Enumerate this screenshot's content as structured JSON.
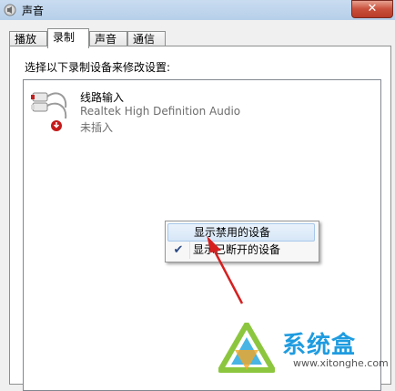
{
  "window": {
    "title": "声音",
    "close_symbol": "✕"
  },
  "tabs": [
    {
      "label": "播放",
      "active": false
    },
    {
      "label": "录制",
      "active": true
    },
    {
      "label": "声音",
      "active": false
    },
    {
      "label": "通信",
      "active": false
    }
  ],
  "instruction": "选择以下录制设备来修改设置:",
  "devices": [
    {
      "name": "线路输入",
      "description": "Realtek High Definition Audio",
      "status": "未插入",
      "icon": "line-in-plug-icon"
    }
  ],
  "context_menu": {
    "items": [
      {
        "label": "显示禁用的设备",
        "checked": false,
        "highlighted": true
      },
      {
        "label": "显示已断开的设备",
        "checked": true,
        "highlighted": false
      }
    ],
    "check_symbol": "✔"
  },
  "watermark": {
    "brand": "系统盒",
    "url": "www.xitonghe.com"
  },
  "colors": {
    "arrow": "#d62020",
    "brand": "#1f9ce0"
  }
}
